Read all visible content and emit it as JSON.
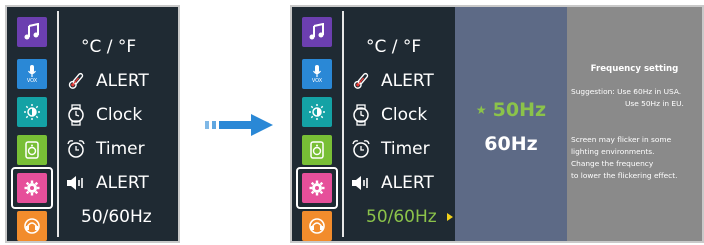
{
  "left_screen": {
    "menu": [
      {
        "label": "°C / °F"
      },
      {
        "label": "ALERT"
      },
      {
        "label": "Clock"
      },
      {
        "label": "Timer"
      },
      {
        "label": "ALERT"
      },
      {
        "label": "50/60Hz"
      }
    ],
    "sidebar_icons": [
      "music-icon",
      "vox-mic-icon",
      "brightness-icon",
      "speaker-icon",
      "gear-icon",
      "sos-icon"
    ],
    "vox_label": "VOX",
    "selected_sidebar": "gear-icon"
  },
  "right_screen": {
    "menu": [
      {
        "label": "°C / °F"
      },
      {
        "label": "ALERT"
      },
      {
        "label": "Clock"
      },
      {
        "label": "Timer"
      },
      {
        "label": "ALERT"
      },
      {
        "label": "50/60Hz"
      }
    ],
    "vox_label": "VOX",
    "active_item": "50/60Hz",
    "frequency_options": [
      {
        "label": "50Hz",
        "selected": true
      },
      {
        "label": "60Hz",
        "selected": false
      }
    ],
    "help": {
      "title": "Frequency setting",
      "suggestion_1": "Suggestion: Use 60Hz in USA.",
      "suggestion_2": "Use 50Hz in EU.",
      "note_1": "Screen may flicker in some",
      "note_2": "lighting environments.",
      "note_3": "Change the frequency",
      "note_4": "to lower the flickering effect."
    }
  },
  "colors": {
    "screen_bg": "#1f2a33",
    "active_green": "#8bc34a",
    "freq_panel_bg": "#5d6a86",
    "help_panel_bg": "#8a8a8a",
    "arrow_blue": "#2a88d6"
  }
}
